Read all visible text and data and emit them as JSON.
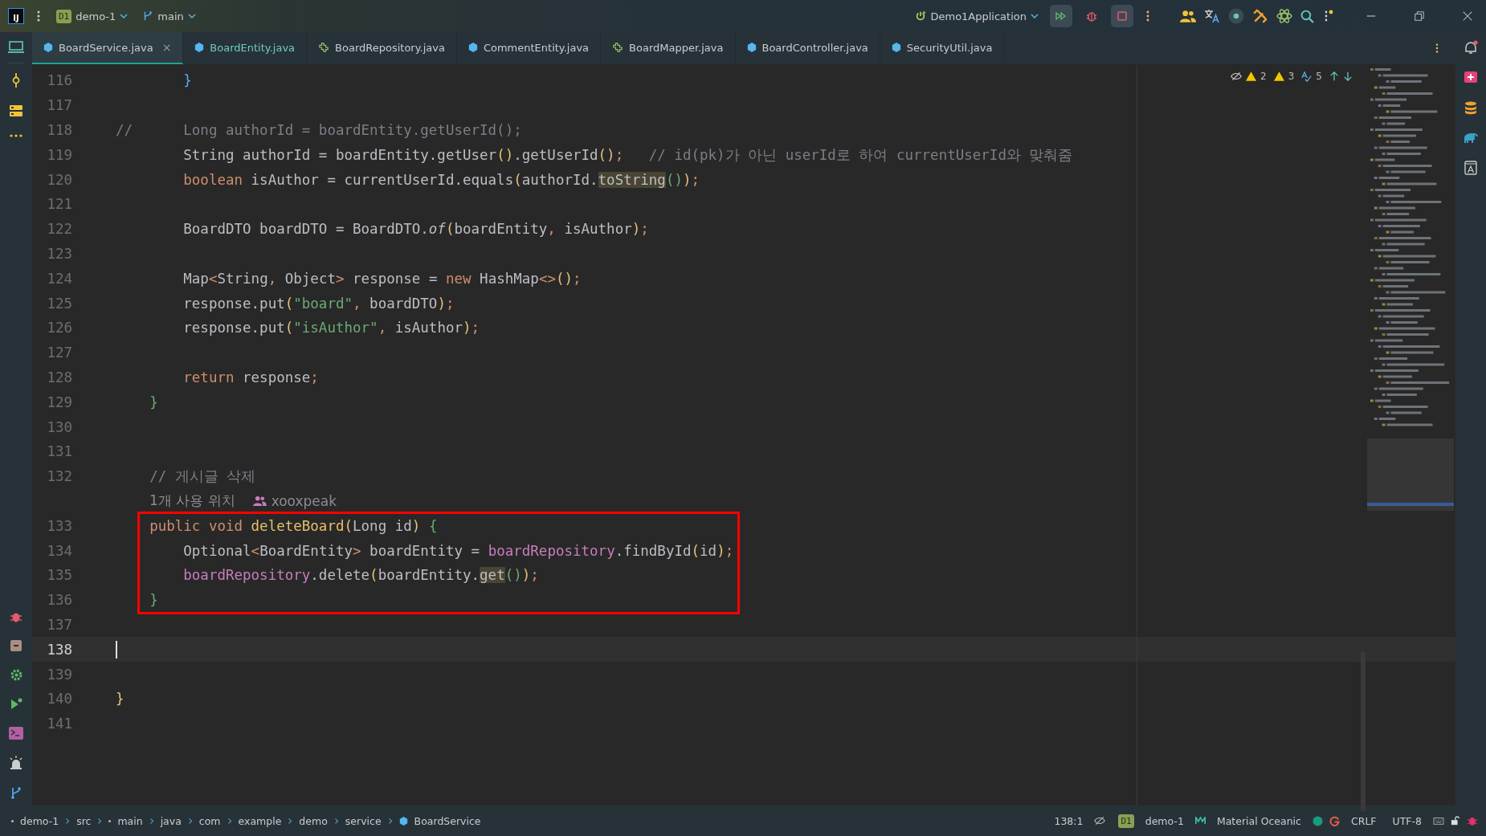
{
  "title_bar": {
    "logo": "IJ",
    "project_badge": "D1",
    "project": "demo-1",
    "branch": "main",
    "run_config": "Demo1Application"
  },
  "tabs": [
    {
      "label": "BoardService.java",
      "kind": "class",
      "selected": true,
      "modified": false,
      "close": "×"
    },
    {
      "label": "BoardEntity.java",
      "kind": "class",
      "selected": false,
      "modified": true
    },
    {
      "label": "BoardRepository.java",
      "kind": "interface",
      "selected": false,
      "modified": false
    },
    {
      "label": "CommentEntity.java",
      "kind": "class",
      "selected": false,
      "modified": false
    },
    {
      "label": "BoardMapper.java",
      "kind": "interface",
      "selected": false,
      "modified": false
    },
    {
      "label": "BoardController.java",
      "kind": "class",
      "selected": false,
      "modified": false
    },
    {
      "label": "SecurityUtil.java",
      "kind": "class",
      "selected": false,
      "modified": false
    }
  ],
  "inspections": {
    "warnings": "2",
    "weak_warnings": "3",
    "typos": "5"
  },
  "blocks": [
    {
      "boxed": false,
      "lines": [
        {
          "kind": "code",
          "number": "116",
          "current": false,
          "tokens": [
            {
              "kind": "brace",
              "text": "        }"
            }
          ]
        },
        {
          "kind": "code",
          "number": "117",
          "current": false
        },
        {
          "kind": "code",
          "number": "118",
          "current": false,
          "tokens": [
            {
              "kind": "comment",
              "text": "//      Long authorId = boardEntity.getUserId();"
            }
          ]
        },
        {
          "kind": "code",
          "number": "119",
          "current": false,
          "tokens": [
            {
              "kind": "plain",
              "text": "        String authorId = boardEntity.getUser"
            },
            {
              "kind": "paren",
              "text": "()"
            },
            {
              "kind": "plain",
              "text": ".getUserId"
            },
            {
              "kind": "paren",
              "text": "()"
            },
            {
              "kind": "punct",
              "text": ";"
            },
            {
              "kind": "comment",
              "text": "   // id(pk)가 아닌 userId로 하여 currentUserId와 맞춰줌"
            }
          ]
        },
        {
          "kind": "code",
          "number": "120",
          "current": false,
          "tokens": [
            {
              "kind": "kw",
              "text": "        boolean"
            },
            {
              "kind": "plain",
              "text": " isAuthor = currentUserId.equals"
            },
            {
              "kind": "paren",
              "text": "("
            },
            {
              "kind": "plain",
              "text": "authorId."
            },
            {
              "kind": "hl",
              "text": "toString"
            },
            {
              "kind": "paren2",
              "text": "()"
            },
            {
              "kind": "paren",
              "text": ")"
            },
            {
              "kind": "punct",
              "text": ";"
            }
          ]
        },
        {
          "kind": "code",
          "number": "121",
          "current": false
        },
        {
          "kind": "code",
          "number": "122",
          "current": false,
          "tokens": [
            {
              "kind": "plain",
              "text": "        BoardDTO boardDTO = BoardDTO."
            },
            {
              "kind": "italic",
              "text": "of"
            },
            {
              "kind": "paren",
              "text": "("
            },
            {
              "kind": "plain",
              "text": "boardEntity"
            },
            {
              "kind": "punct",
              "text": ","
            },
            {
              "kind": "plain",
              "text": " isAuthor"
            },
            {
              "kind": "paren",
              "text": ")"
            },
            {
              "kind": "punct",
              "text": ";"
            }
          ]
        },
        {
          "kind": "code",
          "number": "123",
          "current": false
        },
        {
          "kind": "code",
          "number": "124",
          "current": false,
          "tokens": [
            {
              "kind": "plain",
              "text": "        Map"
            },
            {
              "kind": "punct",
              "text": "<"
            },
            {
              "kind": "plain",
              "text": "String"
            },
            {
              "kind": "punct",
              "text": ","
            },
            {
              "kind": "plain",
              "text": " Object"
            },
            {
              "kind": "punct",
              "text": ">"
            },
            {
              "kind": "plain",
              "text": " response = "
            },
            {
              "kind": "kw",
              "text": "new"
            },
            {
              "kind": "plain",
              "text": " HashMap"
            },
            {
              "kind": "punct",
              "text": "<>"
            },
            {
              "kind": "paren",
              "text": "()"
            },
            {
              "kind": "punct",
              "text": ";"
            }
          ]
        },
        {
          "kind": "code",
          "number": "125",
          "current": false,
          "tokens": [
            {
              "kind": "plain",
              "text": "        response.put"
            },
            {
              "kind": "paren",
              "text": "("
            },
            {
              "kind": "str",
              "text": "\"board\""
            },
            {
              "kind": "punct",
              "text": ","
            },
            {
              "kind": "plain",
              "text": " boardDTO"
            },
            {
              "kind": "paren",
              "text": ")"
            },
            {
              "kind": "punct",
              "text": ";"
            }
          ]
        },
        {
          "kind": "code",
          "number": "126",
          "current": false,
          "tokens": [
            {
              "kind": "plain",
              "text": "        response.put"
            },
            {
              "kind": "paren",
              "text": "("
            },
            {
              "kind": "str",
              "text": "\"isAuthor\""
            },
            {
              "kind": "punct",
              "text": ","
            },
            {
              "kind": "plain",
              "text": " isAuthor"
            },
            {
              "kind": "paren",
              "text": ")"
            },
            {
              "kind": "punct",
              "text": ";"
            }
          ]
        },
        {
          "kind": "code",
          "number": "127",
          "current": false
        },
        {
          "kind": "code",
          "number": "128",
          "current": false,
          "tokens": [
            {
              "kind": "kw",
              "text": "        return"
            },
            {
              "kind": "plain",
              "text": " response"
            },
            {
              "kind": "punct",
              "text": ";"
            }
          ]
        },
        {
          "kind": "code",
          "number": "129",
          "current": false,
          "tokens": [
            {
              "kind": "paren2",
              "text": "    }"
            }
          ]
        },
        {
          "kind": "code",
          "number": "130",
          "current": false
        },
        {
          "kind": "code",
          "number": "131",
          "current": false
        },
        {
          "kind": "code",
          "number": "132",
          "current": false,
          "tokens": [
            {
              "kind": "comment",
              "text": "    // 게시글 삭제"
            }
          ]
        },
        {
          "kind": "hint",
          "usages": "1개 사용 위치",
          "author": "xooxpeak"
        }
      ]
    },
    {
      "boxed": true,
      "lines": [
        {
          "kind": "code",
          "number": "133",
          "current": false,
          "tokens": [
            {
              "kind": "kw",
              "text": "    public void "
            },
            {
              "kind": "fn",
              "text": "deleteBoard"
            },
            {
              "kind": "paren",
              "text": "("
            },
            {
              "kind": "plain",
              "text": "Long id"
            },
            {
              "kind": "paren",
              "text": ")"
            },
            {
              "kind": "paren2",
              "text": " {"
            }
          ]
        },
        {
          "kind": "code",
          "number": "134",
          "current": false,
          "tokens": [
            {
              "kind": "plain",
              "text": "        Optional"
            },
            {
              "kind": "punct",
              "text": "<"
            },
            {
              "kind": "plain",
              "text": "BoardEntity"
            },
            {
              "kind": "punct",
              "text": ">"
            },
            {
              "kind": "plain",
              "text": " boardEntity = "
            },
            {
              "kind": "field",
              "text": "boardRepository"
            },
            {
              "kind": "plain",
              "text": ".findById"
            },
            {
              "kind": "paren",
              "text": "("
            },
            {
              "kind": "plain",
              "text": "id"
            },
            {
              "kind": "paren",
              "text": ")"
            },
            {
              "kind": "punct",
              "text": ";"
            }
          ]
        },
        {
          "kind": "code",
          "number": "135",
          "current": false,
          "tokens": [
            {
              "kind": "field",
              "text": "        boardRepository"
            },
            {
              "kind": "plain",
              "text": ".delete"
            },
            {
              "kind": "paren",
              "text": "("
            },
            {
              "kind": "plain",
              "text": "boardEntity."
            },
            {
              "kind": "hl",
              "text": "get"
            },
            {
              "kind": "paren2",
              "text": "()"
            },
            {
              "kind": "paren",
              "text": ")"
            },
            {
              "kind": "punct",
              "text": ";"
            }
          ]
        },
        {
          "kind": "code",
          "number": "136",
          "current": false,
          "tokens": [
            {
              "kind": "paren2",
              "text": "    }"
            }
          ]
        }
      ]
    },
    {
      "boxed": false,
      "lines": [
        {
          "kind": "code",
          "number": "137",
          "current": false
        },
        {
          "kind": "code",
          "number": "138",
          "current": true
        },
        {
          "kind": "code",
          "number": "139",
          "current": false
        },
        {
          "kind": "code",
          "number": "140",
          "current": false,
          "tokens": [
            {
              "kind": "paren",
              "text": "}"
            }
          ]
        },
        {
          "kind": "code",
          "number": "141",
          "current": false
        }
      ]
    }
  ],
  "status_bar": {
    "breadcrumbs": [
      {
        "label": "demo-1",
        "kind": "module"
      },
      {
        "label": "src",
        "kind": "folder"
      },
      {
        "label": "main",
        "kind": "module"
      },
      {
        "label": "java",
        "kind": "folder"
      },
      {
        "label": "com",
        "kind": "folder"
      },
      {
        "label": "example",
        "kind": "folder"
      },
      {
        "label": "demo",
        "kind": "folder"
      },
      {
        "label": "service",
        "kind": "folder"
      },
      {
        "label": "BoardService",
        "kind": "class"
      }
    ],
    "position": "138:1",
    "project_badge": "D1",
    "project": "demo-1",
    "theme": "Material Oceanic",
    "line_separator": "CRLF",
    "encoding": "UTF-8"
  }
}
